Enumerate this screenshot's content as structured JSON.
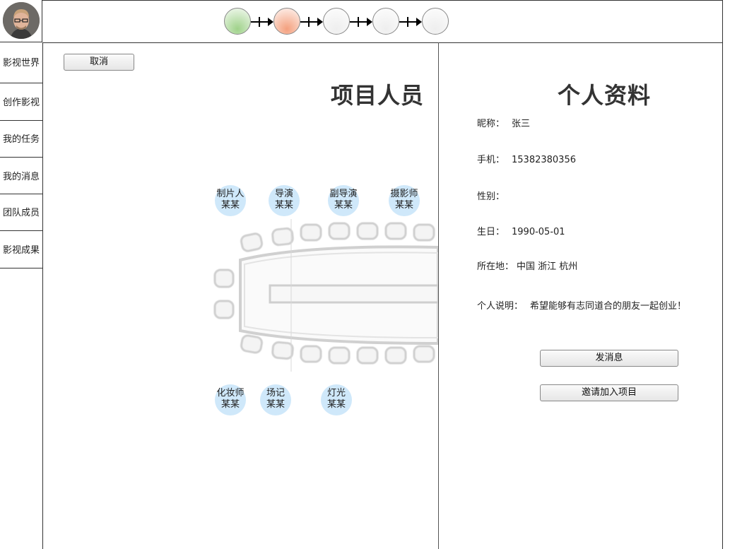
{
  "steps": [
    {
      "state": "done",
      "color": "#9fd28a"
    },
    {
      "state": "current",
      "color": "#f4a07e"
    },
    {
      "state": "pending",
      "color": "#eeeeee"
    },
    {
      "state": "pending",
      "color": "#eeeeee"
    },
    {
      "state": "pending",
      "color": "#eeeeee"
    }
  ],
  "sidebar": {
    "items": [
      {
        "label": "影视世界"
      },
      {
        "label": "创作影视"
      },
      {
        "label": "我的任务"
      },
      {
        "label": "我的消息"
      },
      {
        "label": "团队成员"
      },
      {
        "label": "影视成果"
      }
    ]
  },
  "main": {
    "cancel_label": "取消",
    "title": "项目人员",
    "roles_top": [
      {
        "role": "制片人",
        "name": "某某"
      },
      {
        "role": "导演",
        "name": "某某"
      },
      {
        "role": "副导演",
        "name": "某某"
      },
      {
        "role": "摄影师",
        "name": "某某"
      }
    ],
    "roles_bottom": [
      {
        "role": "化妆师",
        "name": "某某"
      },
      {
        "role": "场记",
        "name": "某某"
      },
      {
        "role": "灯光",
        "name": "某某"
      }
    ]
  },
  "profile": {
    "title": "个人资料",
    "nickname_label": "昵称：",
    "nickname": "张三",
    "phone_label": "手机：",
    "phone": "15382380356",
    "gender_label": "性别：",
    "gender": "",
    "birthday_label": "生日：",
    "birthday": "1990-05-01",
    "location_label": "所在地：",
    "location": "中国 浙江 杭州",
    "bio_label": "个人说明：",
    "bio": "希望能够有志同道合的朋友一起创业！",
    "message_button": "发消息",
    "invite_button": "邀请加入项目"
  }
}
